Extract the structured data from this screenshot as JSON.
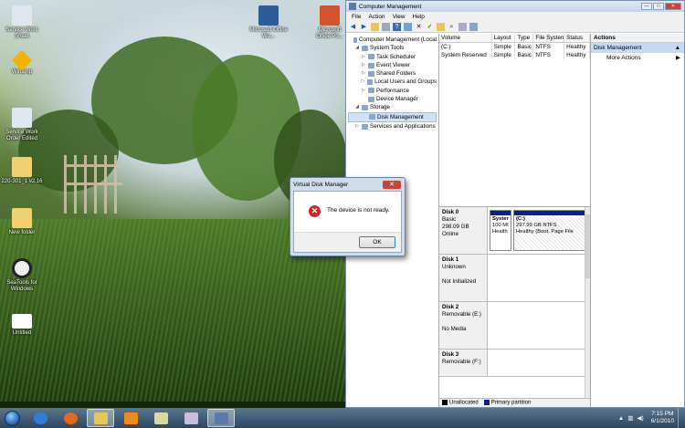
{
  "desktop": {
    "icons": [
      {
        "label": "Service Work Sheet",
        "color": "#dfe6ef"
      },
      {
        "label": "Winamp",
        "color": "#f2b400"
      },
      {
        "label": "Service Work Order Edited",
        "color": "#dfe6ef"
      },
      {
        "label": "220-301_1 v2.16",
        "color": "#f0d070"
      },
      {
        "label": "New folder",
        "color": "#f0d070"
      },
      {
        "label": "SeaTools for Windows",
        "color": "#eeeeee"
      },
      {
        "label": "Untitled",
        "color": "#ffffff"
      },
      {
        "label": "Microsoft Office Wo...",
        "color": "#2b5d9a"
      },
      {
        "label": "Microsoft Office Po...",
        "color": "#d35230"
      }
    ]
  },
  "window": {
    "title": "Computer Management",
    "menu": [
      "File",
      "Action",
      "View",
      "Help"
    ],
    "tree": [
      {
        "label": "Computer Management (Local",
        "level": 0,
        "expander": ""
      },
      {
        "label": "System Tools",
        "level": 1,
        "expander": "◢"
      },
      {
        "label": "Task Scheduler",
        "level": 2,
        "expander": "▷"
      },
      {
        "label": "Event Viewer",
        "level": 2,
        "expander": "▷"
      },
      {
        "label": "Shared Folders",
        "level": 2,
        "expander": "▷"
      },
      {
        "label": "Local Users and Groups",
        "level": 2,
        "expander": "▷"
      },
      {
        "label": "Performance",
        "level": 2,
        "expander": "▷"
      },
      {
        "label": "Device Manager",
        "level": 2,
        "expander": ""
      },
      {
        "label": "Storage",
        "level": 1,
        "expander": "◢"
      },
      {
        "label": "Disk Management",
        "level": 2,
        "expander": "",
        "selected": true
      },
      {
        "label": "Services and Applications",
        "level": 1,
        "expander": "▷"
      }
    ],
    "volume_table": {
      "headers": [
        "Volume",
        "Layout",
        "Type",
        "File System",
        "Status"
      ],
      "rows": [
        [
          "(C:)",
          "Simple",
          "Basic",
          "NTFS",
          "Healthy"
        ],
        [
          "System Reserved",
          "Simple",
          "Basic",
          "NTFS",
          "Healthy"
        ]
      ]
    },
    "disks": [
      {
        "name": "Disk 0",
        "type": "Basic",
        "size": "298.09 GB",
        "state": "Online",
        "partitions": [
          {
            "name": "Syster",
            "line2": "100 MI",
            "line3": "Health"
          },
          {
            "name": "(C:)",
            "line2": "297.99 GB NTFS",
            "line3": "Healthy (Boot, Page File"
          }
        ]
      },
      {
        "name": "Disk 1",
        "type": "Unknown",
        "size": "",
        "state": "Not Initialized",
        "partitions": []
      },
      {
        "name": "Disk 2",
        "type": "Removable (E:)",
        "size": "",
        "state": "No Media",
        "partitions": []
      },
      {
        "name": "Disk 3",
        "type": "Removable (F:)",
        "size": "",
        "state": "",
        "partitions": []
      }
    ],
    "legend": [
      {
        "label": "Unallocated",
        "color": "#000000"
      },
      {
        "label": "Primary partition",
        "color": "#0b1f8a"
      }
    ],
    "actions": {
      "header": "Actions",
      "selected": "Disk Management",
      "more": "More Actions"
    }
  },
  "dialog": {
    "title": "Virtual Disk Manager",
    "message": "The device is not ready.",
    "ok_label": "OK"
  },
  "taskbar": {
    "time": "7:15 PM",
    "date": "6/1/2010",
    "apps": [
      {
        "name": "ie",
        "color": "#2f7fd8"
      },
      {
        "name": "firefox",
        "color": "#e06a1a"
      },
      {
        "name": "explorer",
        "color": "#e9c65a"
      },
      {
        "name": "media-player",
        "color": "#f08a1c"
      },
      {
        "name": "sticky",
        "color": "#d9d9a0"
      },
      {
        "name": "paint",
        "color": "#c9c0d8"
      },
      {
        "name": "computer-management",
        "color": "#5b7aa6"
      }
    ]
  }
}
